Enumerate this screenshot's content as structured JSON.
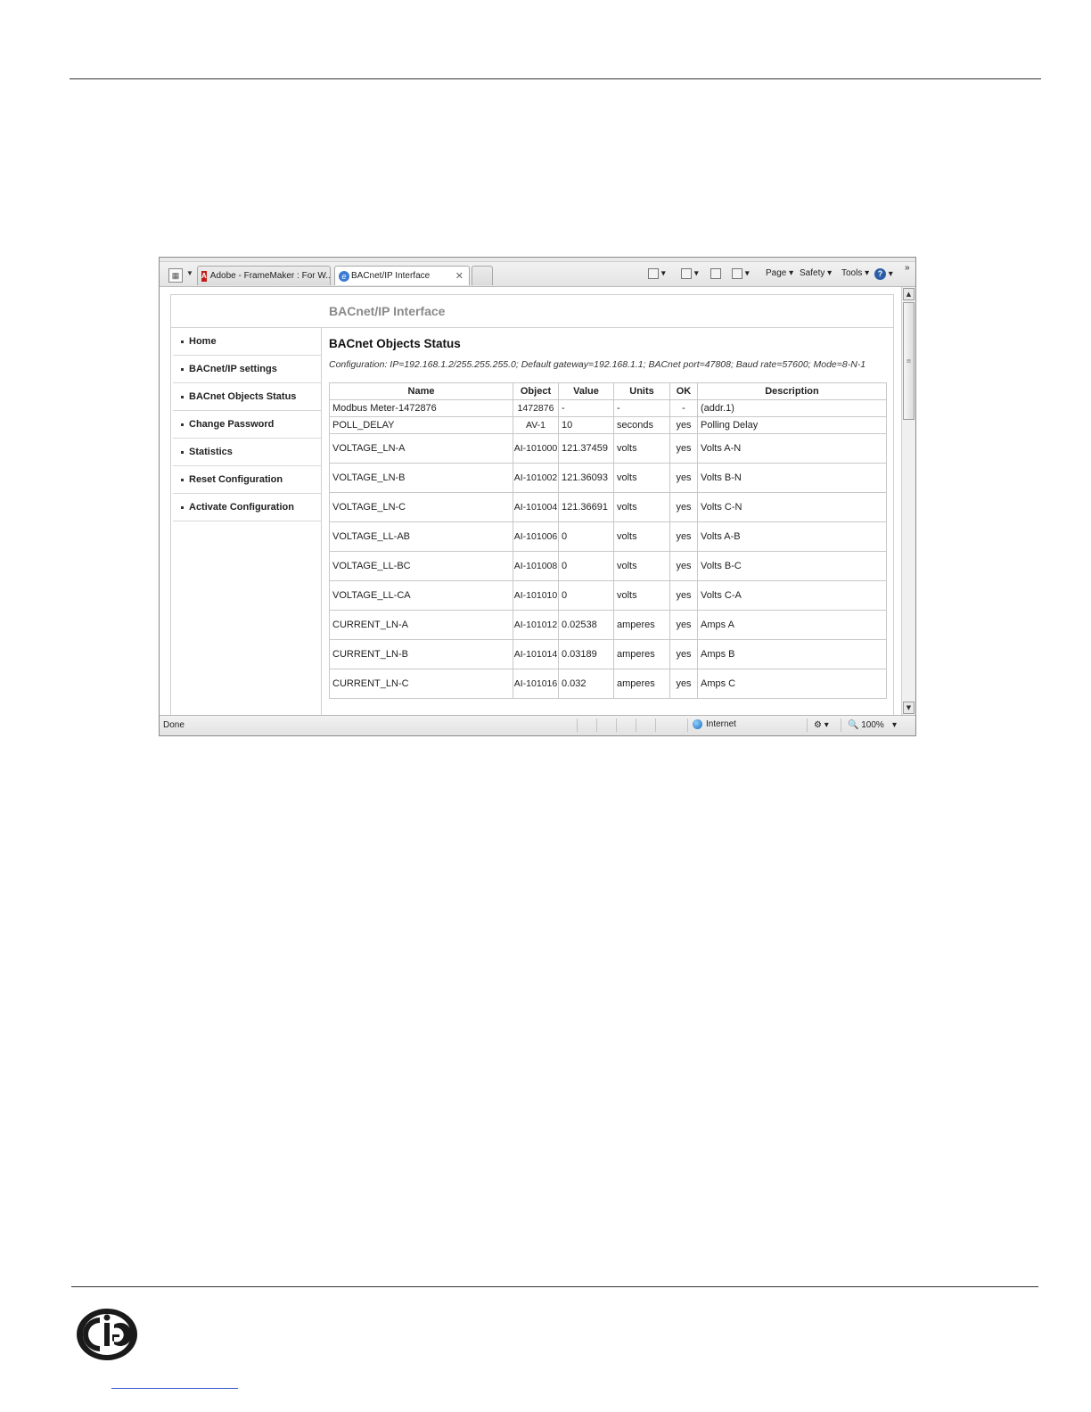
{
  "browser": {
    "tabs": [
      {
        "label": "Adobe - FrameMaker : For W...",
        "icon": "adobe-icon"
      },
      {
        "label": "BACnet/IP Interface",
        "icon": "ie-icon"
      }
    ],
    "toolbar": {
      "page_label": "Page ▾",
      "safety_label": "Safety ▾",
      "tools_label": "Tools ▾",
      "overflow_label": "»"
    },
    "status": {
      "text": "Done",
      "zone": "Internet",
      "zoom": "100%"
    }
  },
  "app": {
    "title": "BACnet/IP Interface",
    "nav": [
      "Home",
      "BACnet/IP settings",
      "BACnet Objects Status",
      "Change Password",
      "Statistics",
      "Reset Configuration",
      "Activate Configuration"
    ],
    "heading": "BACnet Objects Status",
    "config_text": "Configuration: IP=192.168.1.2/255.255.255.0; Default gateway=192.168.1.1; BACnet port=47808; Baud rate=57600; Mode=8-N-1",
    "table": {
      "headers": [
        "Name",
        "Object",
        "Value",
        "Units",
        "OK",
        "Description"
      ],
      "rows": [
        {
          "name": "Modbus Meter-1472876",
          "object": "1472876",
          "value": "-",
          "units": "-",
          "ok": "-",
          "description": "(addr.1)"
        },
        {
          "name": "POLL_DELAY",
          "object": "AV-1",
          "value": "10",
          "units": "seconds",
          "ok": "yes",
          "description": "Polling Delay"
        },
        {
          "name": "VOLTAGE_LN-A",
          "object": "AI-101000",
          "value": "121.37459",
          "units": "volts",
          "ok": "yes",
          "description": "Volts A-N"
        },
        {
          "name": "VOLTAGE_LN-B",
          "object": "AI-101002",
          "value": "121.36093",
          "units": "volts",
          "ok": "yes",
          "description": "Volts B-N"
        },
        {
          "name": "VOLTAGE_LN-C",
          "object": "AI-101004",
          "value": "121.36691",
          "units": "volts",
          "ok": "yes",
          "description": "Volts C-N"
        },
        {
          "name": "VOLTAGE_LL-AB",
          "object": "AI-101006",
          "value": "0",
          "units": "volts",
          "ok": "yes",
          "description": "Volts A-B"
        },
        {
          "name": "VOLTAGE_LL-BC",
          "object": "AI-101008",
          "value": "0",
          "units": "volts",
          "ok": "yes",
          "description": "Volts B-C"
        },
        {
          "name": "VOLTAGE_LL-CA",
          "object": "AI-101010",
          "value": "0",
          "units": "volts",
          "ok": "yes",
          "description": "Volts C-A"
        },
        {
          "name": "CURRENT_LN-A",
          "object": "AI-101012",
          "value": "0.02538",
          "units": "amperes",
          "ok": "yes",
          "description": "Amps A"
        },
        {
          "name": "CURRENT_LN-B",
          "object": "AI-101014",
          "value": "0.03189",
          "units": "amperes",
          "ok": "yes",
          "description": "Amps B"
        },
        {
          "name": "CURRENT_LN-C",
          "object": "AI-101016",
          "value": "0.032",
          "units": "amperes",
          "ok": "yes",
          "description": "Amps C"
        }
      ]
    }
  },
  "footer": {
    "logo": "EIG"
  }
}
